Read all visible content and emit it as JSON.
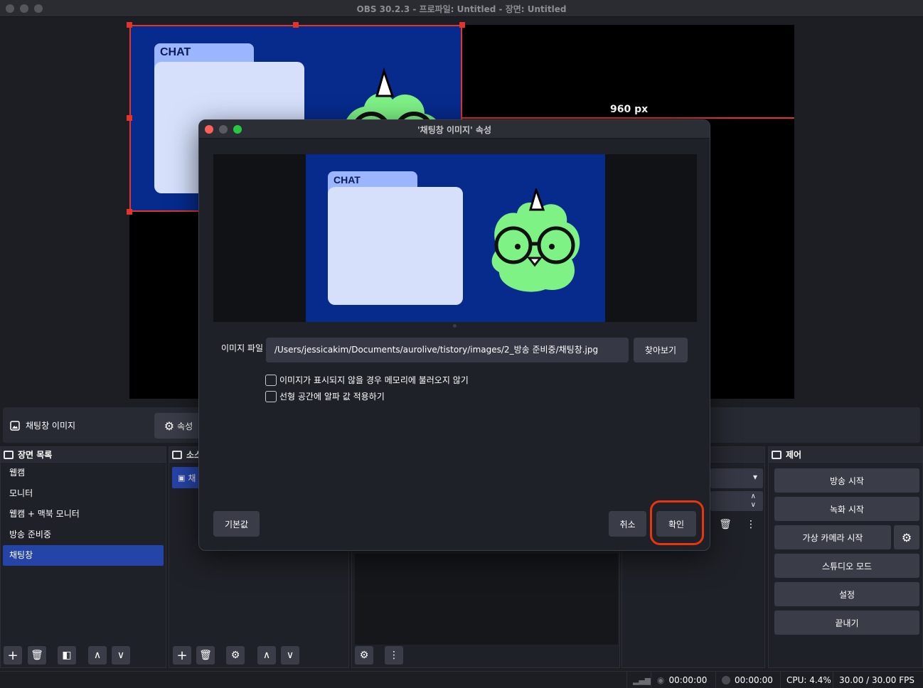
{
  "window": {
    "title": "OBS 30.2.3 - 프로파일: Untitled - 장면: Untitled"
  },
  "preview": {
    "width_label": "960 px",
    "chat_label": "CHAT"
  },
  "source_bar": {
    "source_name": "채팅창 이미지",
    "properties_label": "속성"
  },
  "scenes": {
    "header": "장면 목록",
    "items": [
      {
        "label": "웹캠"
      },
      {
        "label": "모니터"
      },
      {
        "label": "웹캠 + 맥북 모니터"
      },
      {
        "label": "방송 준비중"
      },
      {
        "label": "채팅창"
      }
    ],
    "active_index": 4
  },
  "sources": {
    "header": "소스",
    "item_label": "채"
  },
  "controls": {
    "header": "제어",
    "start_streaming": "방송 시작",
    "start_recording": "녹화 시작",
    "start_virtual_camera": "가상 카메라 시작",
    "studio_mode": "스튜디오 모드",
    "settings": "설정",
    "exit": "끝내기"
  },
  "status": {
    "stream_time": "00:00:00",
    "record_time": "00:00:00",
    "cpu": "CPU: 4.4%",
    "fps": "30.00 / 30.00 FPS"
  },
  "dialog": {
    "title": "'채팅창 이미지' 속성",
    "image_file_label": "이미지 파일",
    "image_path": "/Users/jessicakim/Documents/aurolive/tistory/images/2_방송 준비중/채팅창.jpg",
    "browse_label": "찾아보기",
    "option_unload": "이미지가 표시되지 않을 경우 메모리에 불러오지 않기",
    "option_linear_alpha": "선형 공간에 알파 값 적용하기",
    "defaults_label": "기본값",
    "cancel_label": "취소",
    "ok_label": "확인"
  },
  "colors": {
    "accent": "#2544a8",
    "highlight": "#e8340f",
    "image_bg": "#062b8d",
    "mascot": "#7ef285"
  }
}
